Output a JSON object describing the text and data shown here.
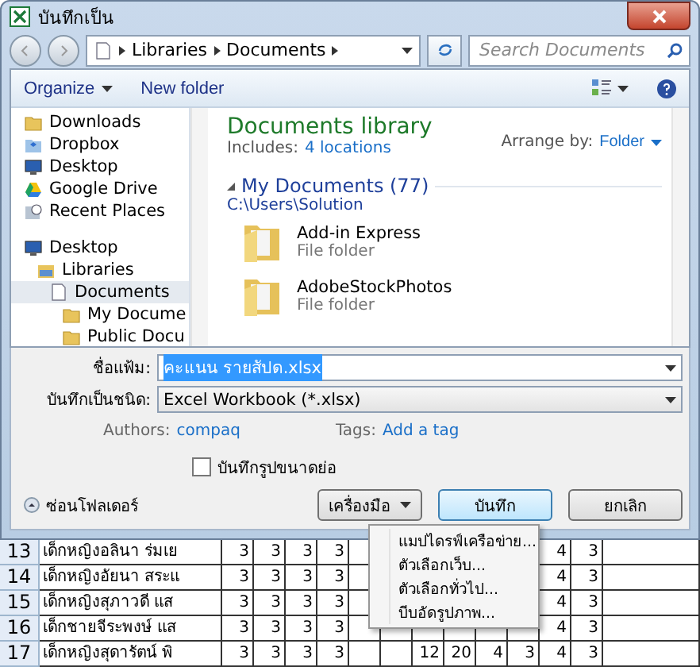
{
  "window": {
    "title": "บันทึกเป็น"
  },
  "address": {
    "crumbs": [
      "Libraries",
      "Documents"
    ],
    "search_placeholder": "Search Documents"
  },
  "toolbar": {
    "organize": "Organize",
    "new_folder": "New folder"
  },
  "nav": [
    {
      "items": [
        {
          "label": "Downloads",
          "kind": "folder",
          "selected": false
        },
        {
          "label": "Dropbox",
          "kind": "dropbox",
          "selected": false
        },
        {
          "label": "Desktop",
          "kind": "desktop",
          "selected": false
        },
        {
          "label": "Google Drive",
          "kind": "drive",
          "selected": false
        },
        {
          "label": "Recent Places",
          "kind": "recent",
          "selected": false
        }
      ]
    },
    {
      "items": [
        {
          "label": "Desktop",
          "kind": "desktop",
          "selected": false,
          "children": [
            {
              "label": "Libraries",
              "kind": "library",
              "selected": false,
              "children": [
                {
                  "label": "Documents",
                  "kind": "document",
                  "selected": true,
                  "children": [
                    {
                      "label": "My Docume",
                      "kind": "folder",
                      "selected": false
                    },
                    {
                      "label": "Public Docu",
                      "kind": "folder",
                      "selected": false
                    }
                  ]
                }
              ]
            }
          ]
        }
      ]
    }
  ],
  "library": {
    "title": "Documents library",
    "includes_label": "Includes:",
    "includes_link": "4 locations",
    "arrange_label": "Arrange by:",
    "arrange_value": "Folder"
  },
  "group": {
    "title": "My Documents (77)",
    "path": "C:\\Users\\Solution",
    "items": [
      {
        "name": "Add-in Express",
        "type": "File folder"
      },
      {
        "name": "AdobeStockPhotos",
        "type": "File folder"
      }
    ]
  },
  "form": {
    "file_name_label": "ชื่อแฟ้ม:",
    "file_name": "คะแนน รายสัปด.xlsx",
    "type_label": "บันทึกเป็นชนิด:",
    "type": "Excel Workbook (*.xlsx)",
    "authors_label": "Authors:",
    "authors": "compaq",
    "tags_label": "Tags:",
    "tags": "Add a tag",
    "thumbnail_label": "บันทึกรูปขนาดย่อ",
    "thumbnail_checked": false
  },
  "footer": {
    "hide_folders": "ซ่อนโฟลเดอร์",
    "tools": "เครื่องมือ",
    "save": "บันทึก",
    "cancel": "ยกเลิก"
  },
  "tools_menu": {
    "items": [
      "แมปไดรฟ์เครือข่าย...",
      "ตัวเลือกเว็บ...",
      "ตัวเลือกทั่วไป...",
      "บีบอัดรูปภาพ..."
    ]
  },
  "sheet": {
    "rows": [
      {
        "number": "13",
        "name": "เด็กหญิงอลินา ร่มเย",
        "cells": [
          "3",
          "3",
          "3",
          "3",
          null,
          null,
          null,
          null,
          null,
          null,
          "4",
          "3"
        ]
      },
      {
        "number": "14",
        "name": "เด็กหญิงอัยนา สระแ",
        "cells": [
          "3",
          "3",
          "3",
          "3",
          null,
          null,
          null,
          null,
          null,
          null,
          "4",
          "3"
        ]
      },
      {
        "number": "15",
        "name": "เด็กหญิงสุภาวดี แส",
        "cells": [
          "3",
          "3",
          "3",
          "3",
          null,
          null,
          null,
          null,
          null,
          null,
          "4",
          "3"
        ]
      },
      {
        "number": "16",
        "name": "เด็กชายจีระพงษ์ แส",
        "cells": [
          "3",
          "3",
          "3",
          "3",
          null,
          null,
          null,
          null,
          null,
          null,
          "4",
          "3"
        ]
      },
      {
        "number": "17",
        "name": "เด็กหญิงสุดารัตน์ พิ",
        "cells": [
          "3",
          "3",
          "3",
          "3",
          null,
          null,
          "12",
          "20",
          "4",
          "3",
          "4",
          "3"
        ]
      }
    ]
  }
}
